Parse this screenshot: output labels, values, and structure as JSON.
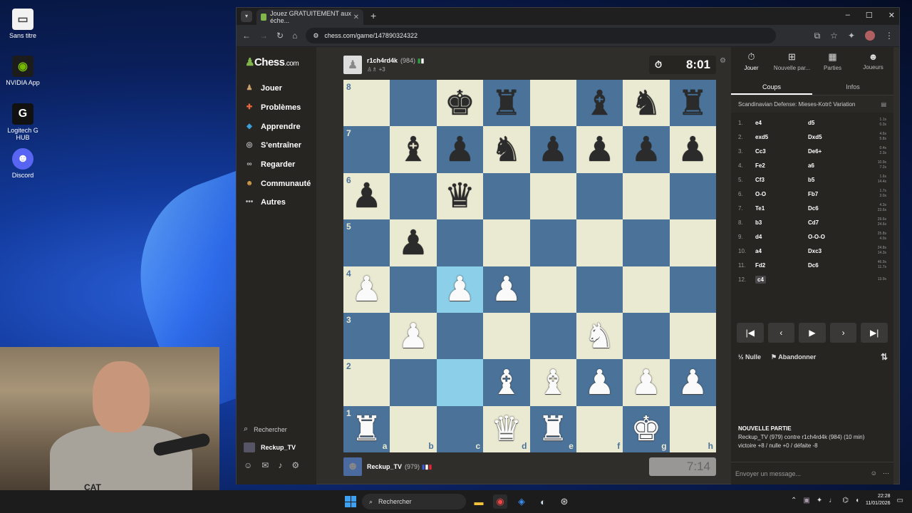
{
  "desktop": {
    "icons": [
      {
        "label": "Sans titre",
        "icon": "document-icon"
      },
      {
        "label": "NVIDIA App",
        "icon": "nvidia-icon"
      },
      {
        "label": "Logitech G HUB",
        "icon": "logitech-icon"
      },
      {
        "label": "Discord",
        "icon": "discord-icon"
      }
    ]
  },
  "browser": {
    "tab_title": "Jouez GRATUITEMENT aux éche...",
    "url": "chess.com/game/147890324322"
  },
  "sidebar": {
    "logo_main": "Chess",
    "logo_suffix": ".com",
    "items": [
      {
        "label": "Jouer",
        "icon": "pawn-play-icon",
        "color": "#c9a26b"
      },
      {
        "label": "Problèmes",
        "icon": "puzzle-icon",
        "color": "#e8663d"
      },
      {
        "label": "Apprendre",
        "icon": "graduation-cap-icon",
        "color": "#3aa0d9"
      },
      {
        "label": "S'entraîner",
        "icon": "target-icon",
        "color": "#bbbbbb"
      },
      {
        "label": "Regarder",
        "icon": "binoculars-icon",
        "color": "#bbbbbb"
      },
      {
        "label": "Communauté",
        "icon": "community-icon",
        "color": "#d8a24a"
      },
      {
        "label": "Autres",
        "icon": "more-dots-icon",
        "color": "#bbbbbb"
      }
    ],
    "search_label": "Rechercher",
    "user_label": "Reckup_TV"
  },
  "game": {
    "top_player": {
      "name": "r1ch4rd4k",
      "rating": "(984)",
      "captured": "+3"
    },
    "top_clock": "8:01",
    "bottom_player": {
      "name": "Reckup_TV",
      "rating": "(979)"
    },
    "bottom_clock": "7:14",
    "files": [
      "a",
      "b",
      "c",
      "d",
      "e",
      "f",
      "g",
      "h"
    ],
    "ranks": [
      "8",
      "7",
      "6",
      "5",
      "4",
      "3",
      "2",
      "1"
    ],
    "board": [
      [
        "",
        "",
        "bk",
        "br",
        "",
        "bb",
        "bn",
        "br"
      ],
      [
        "",
        "bb",
        "bp",
        "bn",
        "bp",
        "bp",
        "bp",
        "bp"
      ],
      [
        "bp",
        "",
        "bq",
        "",
        "",
        "",
        "",
        ""
      ],
      [
        "",
        "bp",
        "",
        "",
        "",
        "",
        "",
        ""
      ],
      [
        "wp",
        "",
        "wp",
        "wp",
        "",
        "",
        "",
        ""
      ],
      [
        "",
        "wp",
        "",
        "",
        "",
        "wn",
        "",
        ""
      ],
      [
        "",
        "",
        "",
        "wb",
        "wb",
        "wp",
        "wp",
        "wp"
      ],
      [
        "wr",
        "",
        "",
        "wq",
        "wr",
        "",
        "wk",
        ""
      ]
    ]
  },
  "panel": {
    "tabs": [
      {
        "label": "Jouer",
        "icon": "stopwatch-icon"
      },
      {
        "label": "Nouvelle par...",
        "icon": "plus-square-icon"
      },
      {
        "label": "Parties",
        "icon": "board-icon"
      },
      {
        "label": "Joueurs",
        "icon": "players-icon"
      }
    ],
    "subtabs": [
      "Coups",
      "Infos"
    ],
    "opening": "Scandinavian Defense: Mieses-Kotrč Variation",
    "moves": [
      {
        "n": "1.",
        "w": "e4",
        "b": "d5",
        "tw": "1.1s",
        "tb": "0.3s"
      },
      {
        "n": "2.",
        "w": "exd5",
        "b": "Dxd5",
        "tw": "4.6s",
        "tb": "5.8s"
      },
      {
        "n": "3.",
        "w": "Cc3",
        "b": "De6+",
        "tw": "0.4s",
        "tb": "2.3s"
      },
      {
        "n": "4.",
        "w": "Fe2",
        "b": "a6",
        "tw": "10.9s",
        "tb": "7.2s"
      },
      {
        "n": "5.",
        "w": "Cf3",
        "b": "b5",
        "tw": "1.6s",
        "tb": "14.4s"
      },
      {
        "n": "6.",
        "w": "O-O",
        "b": "Fb7",
        "tw": "1.7s",
        "tb": "3.0s"
      },
      {
        "n": "7.",
        "w": "Te1",
        "b": "Dc6",
        "tw": "4.3s",
        "tb": "23.6s"
      },
      {
        "n": "8.",
        "w": "b3",
        "b": "Cd7",
        "tw": "29.6s",
        "tb": "24.6s"
      },
      {
        "n": "9.",
        "w": "d4",
        "b": "O-O-O",
        "tw": "25.8s",
        "tb": "4.0s"
      },
      {
        "n": "10.",
        "w": "a4",
        "b": "Dxc3",
        "tw": "24.8s",
        "tb": "14.3s"
      },
      {
        "n": "11.",
        "w": "Fd2",
        "b": "Dc6",
        "tw": "46.9s",
        "tb": "11.7s"
      },
      {
        "n": "12.",
        "w": "c4",
        "b": "",
        "tw": "13.9s",
        "tb": ""
      }
    ],
    "draw_label": "Nulle",
    "resign_label": "Abandonner",
    "new_game_title": "NOUVELLE PARTIE",
    "new_game_line1": "Reckup_TV (979) contre r1ch4rd4k (984) (10 min)",
    "new_game_line2": "victoire +8 / nulle +0 / défaite -8",
    "chat_placeholder": "Envoyer un message..."
  },
  "taskbar": {
    "search_label": "Rechercher",
    "time": "22:28",
    "date": "11/01/2026"
  }
}
